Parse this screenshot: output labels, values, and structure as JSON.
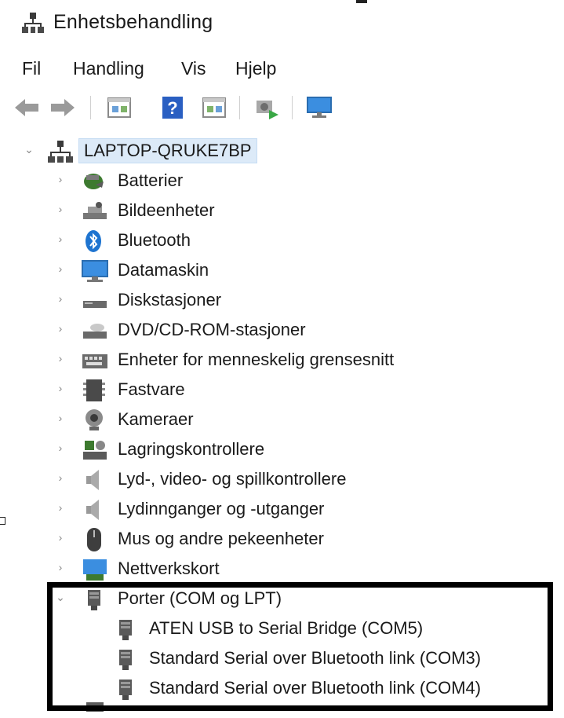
{
  "window": {
    "title": "Enhetsbehandling",
    "icon": "device-manager-icon"
  },
  "menubar": {
    "items": [
      "Fil",
      "Handling",
      "Vis",
      "Hjelp"
    ]
  },
  "toolbar": {
    "buttons": [
      "back-icon",
      "forward-icon",
      "properties-icon",
      "help-icon",
      "view-icon",
      "scan-hardware-icon",
      "monitor-icon"
    ]
  },
  "tree": {
    "root": {
      "label": "LAPTOP-QRUKE7BP",
      "expanded": true
    },
    "categories": [
      {
        "label": "Batterier",
        "icon": "battery-icon"
      },
      {
        "label": "Bildeenheter",
        "icon": "imaging-device-icon"
      },
      {
        "label": "Bluetooth",
        "icon": "bluetooth-icon"
      },
      {
        "label": "Datamaskin",
        "icon": "computer-icon"
      },
      {
        "label": "Diskstasjoner",
        "icon": "disk-drive-icon"
      },
      {
        "label": "DVD/CD-ROM-stasjoner",
        "icon": "dvd-drive-icon"
      },
      {
        "label": "Enheter for menneskelig grensesnitt",
        "icon": "hid-icon"
      },
      {
        "label": "Fastvare",
        "icon": "firmware-icon"
      },
      {
        "label": "Kameraer",
        "icon": "camera-icon"
      },
      {
        "label": "Lagringskontrollere",
        "icon": "storage-controller-icon"
      },
      {
        "label": "Lyd-, video- og spillkontrollere",
        "icon": "sound-icon"
      },
      {
        "label": "Lydinnganger og -utganger",
        "icon": "audio-io-icon"
      },
      {
        "label": "Mus og andre pekeenheter",
        "icon": "mouse-icon"
      },
      {
        "label": "Nettverkskort",
        "icon": "network-adapter-icon"
      }
    ],
    "ports": {
      "label": "Porter (COM og LPT)",
      "expanded": true,
      "children": [
        "ATEN USB to Serial Bridge (COM5)",
        "Standard Serial over Bluetooth link (COM3)",
        "Standard Serial over Bluetooth link (COM4)"
      ]
    }
  },
  "colors": {
    "selection": "#dceaf8",
    "highlight_border": "#000000",
    "accent": "#1e74d0"
  }
}
